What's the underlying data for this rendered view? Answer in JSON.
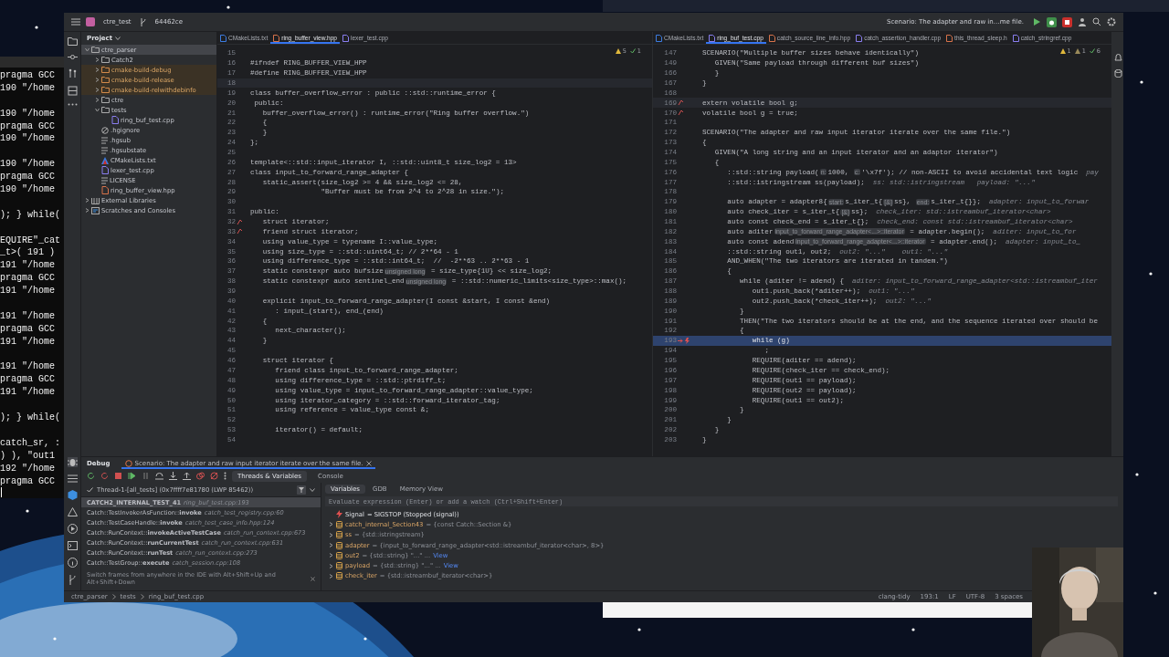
{
  "terminal": {
    "lines": [
      {
        "kind": "text",
        "text": "pragma GCC"
      },
      {
        "kind": "text",
        "text": "190 \"/home"
      },
      {
        "kind": "blank"
      },
      {
        "kind": "text",
        "text": "190 \"/home"
      },
      {
        "kind": "text",
        "text": "pragma GCC"
      },
      {
        "kind": "text",
        "text": "190 \"/home"
      },
      {
        "kind": "blank"
      },
      {
        "kind": "text",
        "text": "190 \"/home"
      },
      {
        "kind": "text",
        "text": "pragma GCC"
      },
      {
        "kind": "text",
        "text": "190 \"/home"
      },
      {
        "kind": "blank"
      },
      {
        "kind": "text",
        "text": "); } while("
      },
      {
        "kind": "blank"
      },
      {
        "kind": "text",
        "text": "EQUIRE\"_cat"
      },
      {
        "kind": "text",
        "text": "_t>( 191 )"
      },
      {
        "kind": "text",
        "text": "191 \"/home"
      },
      {
        "kind": "text",
        "text": "pragma GCC"
      },
      {
        "kind": "text",
        "text": "191 \"/home"
      },
      {
        "kind": "blank"
      },
      {
        "kind": "text",
        "text": "191 \"/home"
      },
      {
        "kind": "text",
        "text": "pragma GCC"
      },
      {
        "kind": "text",
        "text": "191 \"/home"
      },
      {
        "kind": "blank"
      },
      {
        "kind": "text",
        "text": "191 \"/home"
      },
      {
        "kind": "text",
        "text": "pragma GCC"
      },
      {
        "kind": "text",
        "text": "191 \"/home"
      },
      {
        "kind": "blank"
      },
      {
        "kind": "text",
        "text": "); } while("
      },
      {
        "kind": "blank"
      },
      {
        "kind": "text",
        "text": "catch_sr, :"
      },
      {
        "kind": "text",
        "text": ") ), \"out1"
      },
      {
        "kind": "text",
        "text": "192 \"/home"
      },
      {
        "kind": "text",
        "text": "pragma GCC"
      }
    ]
  },
  "titlebar": {
    "project": "ctre_test",
    "branch": "64462ce",
    "run_config": "Scenario: The adapter and raw in…me file."
  },
  "project": {
    "title": "Project",
    "items": [
      {
        "label": "ctre_parser",
        "kind": "folder",
        "expanded": true,
        "selected": true,
        "children": [
          {
            "label": "Catch2",
            "kind": "folder",
            "expanded": false,
            "selected": false
          },
          {
            "label": "cmake-build-debug",
            "kind": "excluded",
            "expanded": false,
            "selected": false
          },
          {
            "label": "cmake-build-release",
            "kind": "excluded",
            "expanded": false,
            "selected": false
          },
          {
            "label": "cmake-build-relwithdebinfo",
            "kind": "excluded",
            "expanded": false,
            "selected": false
          },
          {
            "label": "ctre",
            "kind": "folder",
            "expanded": false,
            "selected": false
          },
          {
            "label": "tests",
            "kind": "folder",
            "expanded": true,
            "selected": false,
            "children": [
              {
                "label": "ring_buf_test.cpp",
                "kind": "cpp",
                "selected": false
              }
            ]
          },
          {
            "label": ".hgignore",
            "kind": "ignore",
            "selected": false
          },
          {
            "label": ".hgsub",
            "kind": "text",
            "selected": false
          },
          {
            "label": ".hgsubstate",
            "kind": "text",
            "selected": false
          },
          {
            "label": "CMakeLists.txt",
            "kind": "cmake",
            "selected": false
          },
          {
            "label": "lexer_test.cpp",
            "kind": "cpp",
            "selected": false
          },
          {
            "label": "LICENSE",
            "kind": "text",
            "selected": false
          },
          {
            "label": "ring_buffer_view.hpp",
            "kind": "hpp",
            "selected": false
          }
        ]
      },
      {
        "label": "External Libraries",
        "kind": "library",
        "expanded": false,
        "selected": false
      },
      {
        "label": "Scratches and Consoles",
        "kind": "scratch",
        "expanded": false,
        "selected": false
      }
    ]
  },
  "editors": [
    {
      "tabs": [
        {
          "label": "CMakeLists.txt",
          "kind": "cmake",
          "selected": false
        },
        {
          "label": "ring_buffer_view.hpp",
          "kind": "hpp",
          "selected": true
        },
        {
          "label": "lexer_test.cpp",
          "kind": "cpp",
          "selected": false
        }
      ],
      "inspections": [
        {
          "kind": "warning",
          "count": "5"
        },
        {
          "kind": "ok",
          "count": "1"
        }
      ],
      "lines": [
        {
          "n": "15",
          "kind": "code"
        },
        {
          "n": "16",
          "kind": "code",
          "text": "#ifndef RING_BUFFER_VIEW_HPP"
        },
        {
          "n": "17",
          "kind": "code",
          "text": "#define RING_BUFFER_VIEW_HPP"
        },
        {
          "n": "18",
          "kind": "caret"
        },
        {
          "n": "19",
          "kind": "code",
          "text": "class buffer_overflow_error : public ::std::runtime_error {"
        },
        {
          "n": "20",
          "kind": "code",
          "text": " public:"
        },
        {
          "n": "21",
          "kind": "code",
          "text": "   buffer_overflow_error() : runtime_error(\"Ring buffer overflow.\")"
        },
        {
          "n": "22",
          "kind": "code",
          "text": "   {"
        },
        {
          "n": "23",
          "kind": "code",
          "text": "   }"
        },
        {
          "n": "24",
          "kind": "code",
          "text": "};"
        },
        {
          "n": "25",
          "kind": "code"
        },
        {
          "n": "26",
          "kind": "code",
          "text": "template<::std::input_iterator I, ::std::uint8_t size_log2 = 13>"
        },
        {
          "n": "27",
          "kind": "code",
          "text": "class input_to_forward_range_adapter {"
        },
        {
          "n": "28",
          "kind": "code",
          "text": "   static_assert(size_log2 >= 4 && size_log2 <= 28,"
        },
        {
          "n": "29",
          "kind": "code",
          "text": "                 \"Buffer must be from 2^4 to 2^28 in size.\");"
        },
        {
          "n": "30",
          "kind": "code"
        },
        {
          "n": "31",
          "kind": "code",
          "text": "public:"
        },
        {
          "n": "32",
          "kind": "override",
          "text": "   struct iterator;"
        },
        {
          "n": "33",
          "kind": "override",
          "text": "   friend struct iterator;"
        },
        {
          "n": "34",
          "kind": "code",
          "text": "   using value_type = typename I::value_type;"
        },
        {
          "n": "35",
          "kind": "code",
          "text": "   using size_type = ::std::uint64_t; // 2**64 - 1"
        },
        {
          "n": "36",
          "kind": "code",
          "text": "   using difference_type = ::std::int64_t;  //  -2**63 .. 2**63 - 1"
        },
        {
          "n": "37",
          "kind": "code",
          "parts": [
            {
              "kind": "code",
              "text": "   static constexpr auto bufsize"
            },
            {
              "kind": "hint",
              "text": "unsigned long"
            },
            {
              "kind": "code",
              "text": " = size_type{1U} << size_log2;"
            }
          ]
        },
        {
          "n": "38",
          "kind": "code",
          "parts": [
            {
              "kind": "code",
              "text": "   static constexpr auto sentinel_end"
            },
            {
              "kind": "hint",
              "text": "unsigned long"
            },
            {
              "kind": "code",
              "text": " = ::std::numeric_limits<size_type>::max();"
            }
          ]
        },
        {
          "n": "39",
          "kind": "code"
        },
        {
          "n": "40",
          "kind": "code",
          "text": "   explicit input_to_forward_range_adapter(I const &start, I const &end)"
        },
        {
          "n": "41",
          "kind": "code",
          "text": "      : input_(start), end_(end)"
        },
        {
          "n": "42",
          "kind": "code",
          "text": "   {"
        },
        {
          "n": "43",
          "kind": "code",
          "text": "      next_character();"
        },
        {
          "n": "44",
          "kind": "code",
          "text": "   }"
        },
        {
          "n": "45",
          "kind": "code"
        },
        {
          "n": "46",
          "kind": "code",
          "text": "   struct iterator {"
        },
        {
          "n": "47",
          "kind": "code",
          "text": "      friend class input_to_forward_range_adapter;"
        },
        {
          "n": "48",
          "kind": "code",
          "text": "      using difference_type = ::std::ptrdiff_t;"
        },
        {
          "n": "49",
          "kind": "code",
          "text": "      using value_type = input_to_forward_range_adapter::value_type;"
        },
        {
          "n": "50",
          "kind": "code",
          "text": "      using iterator_category = ::std::forward_iterator_tag;"
        },
        {
          "n": "51",
          "kind": "code",
          "text": "      using reference = value_type const &;"
        },
        {
          "n": "52",
          "kind": "code"
        },
        {
          "n": "53",
          "kind": "code",
          "text": "      iterator() = default;"
        },
        {
          "n": "54",
          "kind": "code"
        }
      ]
    },
    {
      "tabs": [
        {
          "label": "CMakeLists.txt",
          "kind": "cmake",
          "selected": false
        },
        {
          "label": "ring_buf_test.cpp",
          "kind": "cpp",
          "selected": true
        },
        {
          "label": "catch_source_line_info.hpp",
          "kind": "hpp",
          "selected": false
        },
        {
          "label": "catch_assertion_handler.cpp",
          "kind": "cpp",
          "selected": false
        },
        {
          "label": "this_thread_sleep.h",
          "kind": "hpp",
          "selected": false
        },
        {
          "label": "catch_stringref.cpp",
          "kind": "cpp",
          "selected": false
        }
      ],
      "inspections": [
        {
          "kind": "warning",
          "count": "1"
        },
        {
          "kind": "weak",
          "count": "1"
        },
        {
          "kind": "ok",
          "count": "6"
        }
      ],
      "lines": [
        {
          "n": "147",
          "kind": "code",
          "text": "SCENARIO(\"Multiple buffer sizes behave identically\")"
        },
        {
          "n": "149",
          "kind": "code",
          "text": "   GIVEN(\"Same payload through different buf sizes\")"
        },
        {
          "n": "166",
          "kind": "code",
          "text": "   }"
        },
        {
          "n": "167",
          "kind": "code",
          "text": "}"
        },
        {
          "n": "168",
          "kind": "code"
        },
        {
          "n": "169",
          "kind": "caret-override",
          "text": "extern volatile bool g;"
        },
        {
          "n": "170",
          "kind": "override",
          "text": "volatile bool g = true;"
        },
        {
          "n": "171",
          "kind": "code"
        },
        {
          "n": "172",
          "kind": "code",
          "text": "SCENARIO(\"The adapter and raw input iterator iterate over the same file.\")"
        },
        {
          "n": "173",
          "kind": "code",
          "text": "{"
        },
        {
          "n": "174",
          "kind": "code",
          "text": "   GIVEN(\"A long string and an input iterator and an adaptor iterator\")"
        },
        {
          "n": "175",
          "kind": "code",
          "text": "   {"
        },
        {
          "n": "176",
          "kind": "code",
          "parts": [
            {
              "kind": "code",
              "text": "      ::std::string payload("
            },
            {
              "kind": "hint",
              "text": "n:"
            },
            {
              "kind": "code",
              "text": "1000, "
            },
            {
              "kind": "hint",
              "text": "c:"
            },
            {
              "kind": "code",
              "text": "'\\x7f'); // non-ASCII to avoid accidental text logic"
            },
            {
              "kind": "value",
              "text": "pay"
            }
          ]
        },
        {
          "n": "177",
          "kind": "code",
          "parts": [
            {
              "kind": "code",
              "text": "      ::std::istringstream ss(payload);"
            },
            {
              "kind": "value",
              "text": "ss: std::istringstream   payload: \"...\""
            }
          ]
        },
        {
          "n": "178",
          "kind": "code"
        },
        {
          "n": "179",
          "kind": "code",
          "parts": [
            {
              "kind": "code",
              "text": "      auto adapter = adapter8{"
            },
            {
              "kind": "hint",
              "text": "start:"
            },
            {
              "kind": "code",
              "text": "s_iter_t{"
            },
            {
              "kind": "hint",
              "text": "[&]"
            },
            {
              "kind": "code",
              "text": "ss}, "
            },
            {
              "kind": "hint",
              "text": "end:"
            },
            {
              "kind": "code",
              "text": "s_iter_t{}};"
            },
            {
              "kind": "value",
              "text": "adapter: input_to_forwar"
            }
          ]
        },
        {
          "n": "180",
          "kind": "code",
          "parts": [
            {
              "kind": "code",
              "text": "      auto check_iter = s_iter_t{"
            },
            {
              "kind": "hint",
              "text": "[&]"
            },
            {
              "kind": "code",
              "text": "ss};"
            },
            {
              "kind": "value",
              "text": "check_iter: std::istreambuf_iterator<char>"
            }
          ]
        },
        {
          "n": "181",
          "kind": "code",
          "parts": [
            {
              "kind": "code",
              "text": "      auto const check_end = s_iter_t{};"
            },
            {
              "kind": "value",
              "text": "check_end: const std::istreambuf_iterator<char>"
            }
          ]
        },
        {
          "n": "182",
          "kind": "code",
          "parts": [
            {
              "kind": "code",
              "text": "      auto aditer"
            },
            {
              "kind": "hint",
              "text": "input_to_forward_range_adapter<...>::iterator"
            },
            {
              "kind": "code",
              "text": " = adapter.begin();"
            },
            {
              "kind": "value",
              "text": "aditer: input_to_for"
            }
          ]
        },
        {
          "n": "183",
          "kind": "code",
          "parts": [
            {
              "kind": "code",
              "text": "      auto const adend"
            },
            {
              "kind": "hint",
              "text": "input_to_forward_range_adapter<...>::iterator"
            },
            {
              "kind": "code",
              "text": " = adapter.end();"
            },
            {
              "kind": "value",
              "text": "adapter: input_to_"
            }
          ]
        },
        {
          "n": "184",
          "kind": "code",
          "parts": [
            {
              "kind": "code",
              "text": "      ::std::string out1, out2;"
            },
            {
              "kind": "value",
              "text": "out2: \"...\"    out1: \"...\""
            }
          ]
        },
        {
          "n": "185",
          "kind": "code",
          "text": "      AND_WHEN(\"The two iterators are iterated in tandem.\")"
        },
        {
          "n": "186",
          "kind": "code",
          "text": "      {"
        },
        {
          "n": "187",
          "kind": "code",
          "parts": [
            {
              "kind": "code",
              "text": "         while (aditer != adend) {"
            },
            {
              "kind": "value",
              "text": "aditer: input_to_forward_range_adapter<std::istreambuf_iter"
            }
          ]
        },
        {
          "n": "188",
          "kind": "code",
          "parts": [
            {
              "kind": "code",
              "text": "            out1.push_back(*aditer++);"
            },
            {
              "kind": "value",
              "text": "out1: \"...\""
            }
          ]
        },
        {
          "n": "189",
          "kind": "code",
          "parts": [
            {
              "kind": "code",
              "text": "            out2.push_back(*check_iter++);"
            },
            {
              "kind": "value",
              "text": "out2: \"...\""
            }
          ]
        },
        {
          "n": "190",
          "kind": "code",
          "text": "         }"
        },
        {
          "n": "191",
          "kind": "code",
          "text": "         THEN(\"The two iterators should be at the end, and the sequence iterated over should be"
        },
        {
          "n": "192",
          "kind": "code",
          "text": "         {"
        },
        {
          "n": "193",
          "kind": "exec",
          "text": "            while (g)"
        },
        {
          "n": "194",
          "kind": "code",
          "text": "               ;"
        },
        {
          "n": "195",
          "kind": "code",
          "text": "            REQUIRE(aditer == adend);"
        },
        {
          "n": "196",
          "kind": "code",
          "text": "            REQUIRE(check_iter == check_end);"
        },
        {
          "n": "197",
          "kind": "code",
          "text": "            REQUIRE(out1 == payload);"
        },
        {
          "n": "198",
          "kind": "code",
          "text": "            REQUIRE(out2 == payload);"
        },
        {
          "n": "199",
          "kind": "code",
          "text": "            REQUIRE(out1 == out2);"
        },
        {
          "n": "200",
          "kind": "code",
          "text": "         }"
        },
        {
          "n": "201",
          "kind": "code",
          "text": "      }"
        },
        {
          "n": "202",
          "kind": "code",
          "text": "   }"
        },
        {
          "n": "203",
          "kind": "code",
          "text": "}"
        }
      ]
    }
  ],
  "debug": {
    "title": "Debug",
    "session": "Scenario: The adapter and raw input iterator iterate over the same file.",
    "tabs": [
      {
        "label": "Threads & Variables",
        "selected": true
      },
      {
        "label": "Console",
        "selected": false
      }
    ],
    "thread": "Thread-1-[all_tests] (0x7ffff7e81780 (LWP 85462))",
    "frames": [
      {
        "function": "CATCH2_INTERNAL_TEST_41",
        "location": "ring_buf_test.cpp:193",
        "selected": true
      },
      {
        "function": "Catch::TestInvokerAsFunction::**invoke**",
        "location": "catch_test_registry.cpp:60",
        "selected": false
      },
      {
        "function": "Catch::TestCaseHandle::**invoke**",
        "location": "catch_test_case_info.hpp:124",
        "selected": false
      },
      {
        "function": "Catch::RunContext::**invokeActiveTestCase**",
        "location": "catch_run_context.cpp:673",
        "selected": false
      },
      {
        "function": "Catch::RunContext::**runCurrentTest**",
        "location": "catch_run_context.cpp:631",
        "selected": false
      },
      {
        "function": "Catch::RunContext::**runTest**",
        "location": "catch_run_context.cpp:273",
        "selected": false
      },
      {
        "function": "Catch::TestGroup::**execute**",
        "location": "catch_session.cpp:108",
        "selected": false
      }
    ],
    "tip": "Switch frames from anywhere in the IDE with Alt+Shift+Up and Alt+Shift+Down",
    "subtabs": [
      {
        "label": "Variables",
        "selected": true
      },
      {
        "label": "GDB",
        "selected": false
      },
      {
        "label": "Memory View",
        "selected": false
      }
    ],
    "evaluate_placeholder": "Evaluate expression (Enter) or add a watch (Ctrl+Shift+Enter)",
    "variables": [
      {
        "kind": "signal",
        "name": "Signal",
        "value": "= SIGSTOP (Stopped (signal))"
      },
      {
        "kind": "var",
        "name": "catch_internal_Section43",
        "value": "= {const Catch::Section &}",
        "expanded": false
      },
      {
        "kind": "var",
        "name": "ss",
        "value": "= {std::istringstream}",
        "expanded": false
      },
      {
        "kind": "var",
        "name": "adapter",
        "value": "= {input_to_forward_range_adapter<std::istreambuf_iterator<char>, 8>}",
        "expanded": false
      },
      {
        "kind": "var",
        "name": "out2",
        "value": "= {std::string} \"...\" ...",
        "link": "View",
        "expanded": false
      },
      {
        "kind": "var",
        "name": "payload",
        "value": "= {std::string} \"...\" ...",
        "link": "View",
        "expanded": false
      },
      {
        "kind": "var",
        "name": "check_iter",
        "value": "= {std::istreambuf_iterator<char>}",
        "expanded": false
      }
    ]
  },
  "status": {
    "breadcrumbs": [
      "ctre_parser",
      "tests",
      "ring_buf_test.cpp"
    ],
    "items": [
      "clang-tidy",
      "193:1",
      "LF",
      "UTF-8",
      "3 spaces"
    ]
  }
}
